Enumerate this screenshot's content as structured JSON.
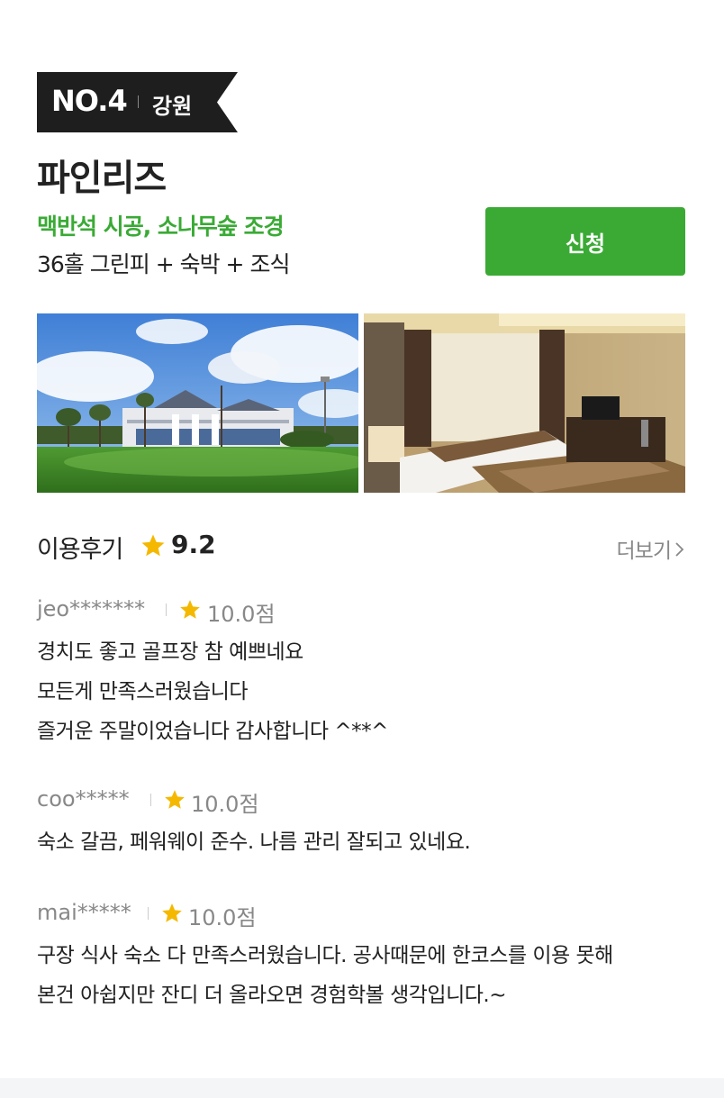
{
  "rank": {
    "number": "NO.4",
    "region": "강원"
  },
  "course": {
    "name": "파인리즈",
    "highlight": "맥반석 시공, 소나무숲 조경",
    "package": "36홀 그린피 + 숙박 + 조식"
  },
  "apply_button": {
    "label": "신청"
  },
  "photos": {
    "exterior_icon": "golf-clubhouse-photo",
    "room_icon": "hotel-room-photo"
  },
  "reviews_section": {
    "title": "이용후기",
    "score": "9.2",
    "more_label": "더보기",
    "items": [
      {
        "user": "jeo*******",
        "score": "10.0점",
        "lines": [
          "경치도 좋고 골프장 참 예쁘네요",
          "모든게 만족스러웠습니다",
          "즐거운 주말이었습니다 감사합니다 ^**^"
        ]
      },
      {
        "user": "coo*****",
        "score": "10.0점",
        "lines": [
          "숙소 갈끔, 페워웨이 준수. 나름 관리 잘되고 있네요."
        ]
      },
      {
        "user": "mai*****",
        "score": "10.0점",
        "lines": [
          "구장 식사 숙소 다 만족스러웠습니다. 공사때문에 한코스를 이용 못해",
          "본건 아쉽지만 잔디 더 올라오면 경험학볼 생각입니다.~"
        ]
      }
    ]
  },
  "colors": {
    "accent_green": "#3aaa35",
    "badge_black": "#1e1e1e",
    "star_yellow": "#f5b800",
    "muted_gray": "#888888"
  }
}
